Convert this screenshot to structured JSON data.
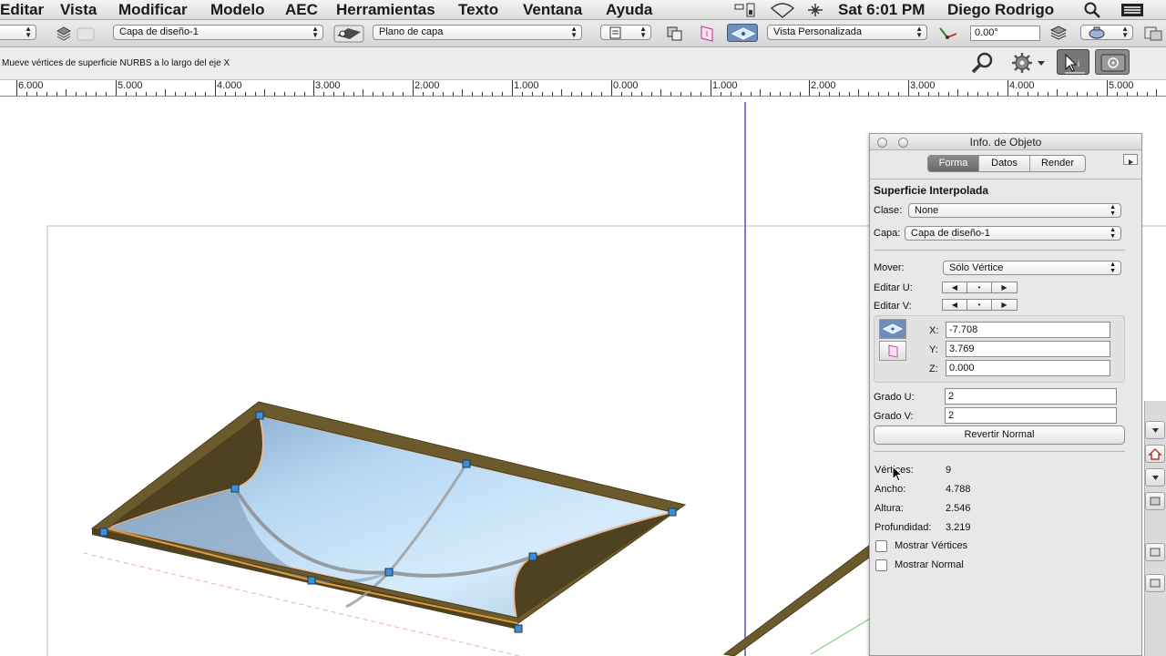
{
  "menubar": {
    "items": [
      "Editar",
      "Vista",
      "Modificar",
      "Modelo",
      "AEC",
      "Herramientas",
      "Texto",
      "Ventana",
      "Ayuda"
    ],
    "clock": "Sat 6:01 PM",
    "user": "Diego Rodrigo"
  },
  "toolbar": {
    "class_popup": "",
    "layer_popup": "Capa de diseño-1",
    "plane_popup": "Plano de capa",
    "view_popup": "Vista Personalizada",
    "rotation_field": "0.00°"
  },
  "modebar": {
    "hint": "Mueve vértices de superficie NURBS a lo largo del eje X"
  },
  "ruler": {
    "labels": [
      "6.000",
      "5.000",
      "4.000",
      "3.000",
      "2.000",
      "1.000",
      "0.000",
      "1.000",
      "2.000",
      "3.000",
      "4.000",
      "5.000"
    ]
  },
  "palette": {
    "title": "Info. de Objeto",
    "tabs": [
      "Forma",
      "Datos",
      "Render"
    ],
    "active_tab": "Forma",
    "object_type": "Superficie Interpolada",
    "clase_label": "Clase:",
    "clase_value": "None",
    "capa_label": "Capa:",
    "capa_value": "Capa de diseño-1",
    "mover_label": "Mover:",
    "mover_value": "Sólo Vértice",
    "editar_u_label": "Editar U:",
    "editar_v_label": "Editar V:",
    "seg_symbols": [
      "◀",
      "•",
      "▶"
    ],
    "x_label": "X:",
    "x_value": "-7.708",
    "y_label": "Y:",
    "y_value": "3.769",
    "z_label": "Z:",
    "z_value": "0.000",
    "grado_u_label": "Grado U:",
    "grado_u_value": "2",
    "grado_v_label": "Grado V:",
    "grado_v_value": "2",
    "revert_button": "Revertir Normal",
    "vertices_label": "Vértices:",
    "vertices_value": "9",
    "ancho_label": "Ancho:",
    "ancho_value": "4.788",
    "altura_label": "Altura:",
    "altura_value": "2.546",
    "profundidad_label": "Profundidad:",
    "profundidad_value": "3.219",
    "show_vertices_label": "Mostrar Vértices",
    "show_normal_label": "Mostrar Normal"
  },
  "icons": {
    "apple": "apple-icon",
    "battery": "battery-icon",
    "wifi": "wifi-icon",
    "bluetooth": "bluetooth-icon",
    "spotlight": "search-icon",
    "list": "list-icon"
  },
  "colors": {
    "surface": "#a9cbe6",
    "frame": "#6b5a2c",
    "handle": "#3b8fd4",
    "accent_line": "#7b7bd6"
  }
}
